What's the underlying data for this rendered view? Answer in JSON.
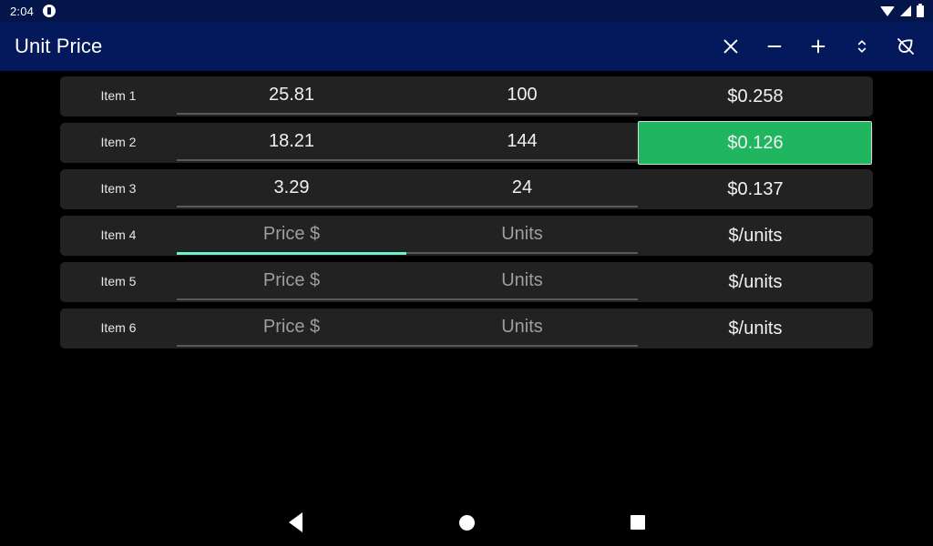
{
  "status_bar": {
    "time": "2:04",
    "notification_icon": "circle-notification-icon",
    "wifi_icon": "wifi-icon",
    "signal_icon": "cell-signal-icon",
    "battery_icon": "battery-icon",
    "background_color": "#04154a"
  },
  "app_bar": {
    "title": "Unit Price",
    "background_color": "#04185c",
    "actions": [
      {
        "name": "close-button",
        "icon": "close-icon",
        "label": "Close"
      },
      {
        "name": "remove-row-button",
        "icon": "minus-icon",
        "label": "Remove"
      },
      {
        "name": "add-row-button",
        "icon": "plus-icon",
        "label": "Add"
      },
      {
        "name": "sort-button",
        "icon": "unfold-more-icon",
        "label": "Sort"
      },
      {
        "name": "eco-off-button",
        "icon": "eco-off-icon",
        "label": "Eco off"
      }
    ]
  },
  "table": {
    "placeholder_price": "Price $",
    "placeholder_units": "Units",
    "placeholder_result": "$/units",
    "highlight_color": "#1fb65f",
    "focus_color": "#6ef3d0",
    "row_color": "#222222",
    "rows": [
      {
        "label": "Item 1",
        "price": "25.81",
        "units": "100",
        "result": "$0.258",
        "highlighted": false,
        "focused": false,
        "price_is_placeholder": false,
        "units_is_placeholder": false
      },
      {
        "label": "Item 2",
        "price": "18.21",
        "units": "144",
        "result": "$0.126",
        "highlighted": true,
        "focused": false,
        "price_is_placeholder": false,
        "units_is_placeholder": false
      },
      {
        "label": "Item 3",
        "price": "3.29",
        "units": "24",
        "result": "$0.137",
        "highlighted": false,
        "focused": false,
        "price_is_placeholder": false,
        "units_is_placeholder": false
      },
      {
        "label": "Item 4",
        "price": "Price $",
        "units": "Units",
        "result": "$/units",
        "highlighted": false,
        "focused": true,
        "price_is_placeholder": true,
        "units_is_placeholder": true
      },
      {
        "label": "Item 5",
        "price": "Price $",
        "units": "Units",
        "result": "$/units",
        "highlighted": false,
        "focused": false,
        "price_is_placeholder": true,
        "units_is_placeholder": true
      },
      {
        "label": "Item 6",
        "price": "Price $",
        "units": "Units",
        "result": "$/units",
        "highlighted": false,
        "focused": false,
        "price_is_placeholder": true,
        "units_is_placeholder": true
      }
    ]
  },
  "nav_bar": {
    "back": "back-triangle-icon",
    "home": "home-circle-icon",
    "recents": "recents-square-icon"
  }
}
